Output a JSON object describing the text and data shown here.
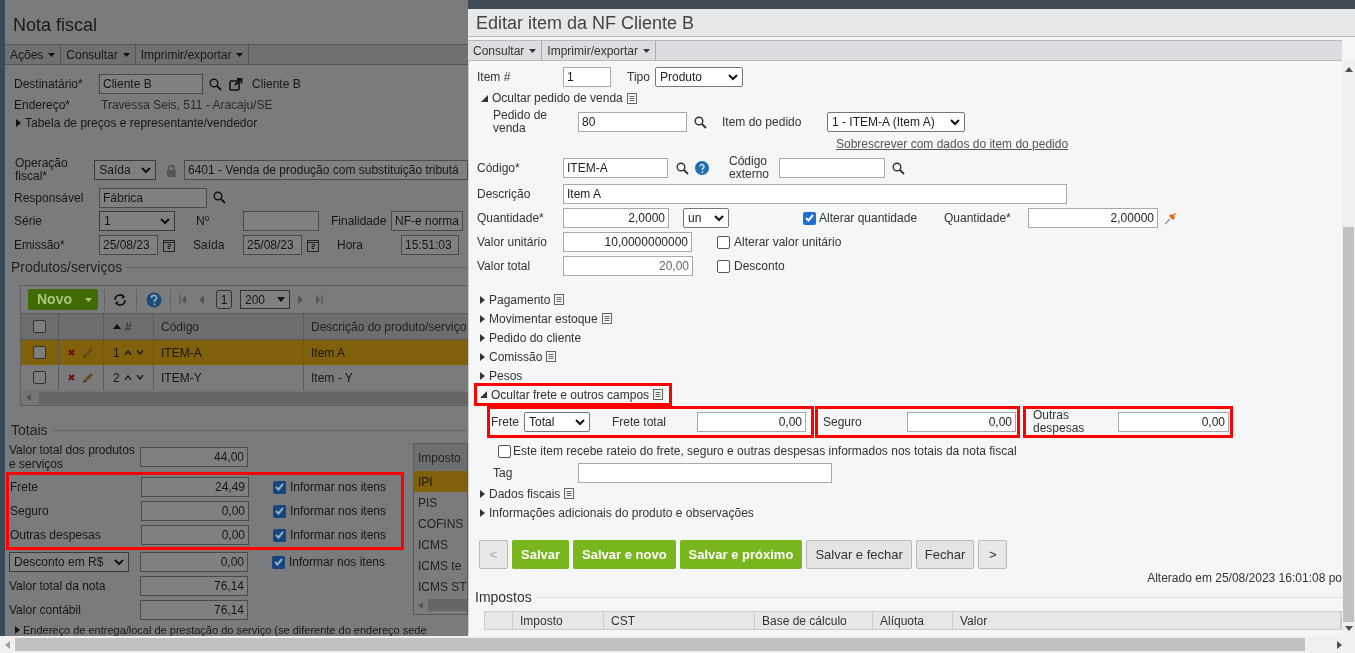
{
  "nota_fiscal": {
    "title": "Nota fiscal",
    "menu": [
      {
        "label": "Ações"
      },
      {
        "label": "Consultar"
      },
      {
        "label": "Imprimir/exportar"
      }
    ],
    "recipient": {
      "label": "Destinatário*",
      "value": "Cliente B",
      "link": "Cliente B"
    },
    "address": {
      "label": "Endereço*",
      "value": "Travessa Seis, 511 - Aracaju/SE"
    },
    "price_table_toggle": "Tabela de preços e representante/vendedor",
    "operation": {
      "label": "Operação fiscal*",
      "direction": "Saída",
      "cfop": "6401 - Venda de produção com substituição tributá"
    },
    "responsible": {
      "label": "Responsável",
      "value": "Fábrica"
    },
    "series": {
      "label": "Série",
      "value": "1"
    },
    "number": {
      "label": "Nº"
    },
    "purpose": {
      "label": "Finalidade",
      "value": "NF-e norma"
    },
    "issue_date": {
      "label": "Emissão*",
      "value": "25/08/23"
    },
    "exit_date": {
      "label": "Saída",
      "value": "25/08/23"
    },
    "time": {
      "label": "Hora",
      "value": "15:51:03"
    },
    "products": {
      "heading": "Produtos/serviços",
      "new_button": "Novo",
      "page": "1",
      "page_size": "200",
      "select_all_checked": false,
      "columns": [
        "#",
        "Código",
        "Descrição do produto/serviço"
      ],
      "rows": [
        {
          "number": "1",
          "code": "ITEM-A",
          "description": "Item A",
          "selected": true,
          "checked": false
        },
        {
          "number": "2",
          "code": "ITEM-Y",
          "description": "Item - Y",
          "selected": false,
          "checked": false
        }
      ]
    },
    "totals": {
      "heading": "Totais",
      "rows": [
        {
          "kind": "readonly",
          "label": "Valor total dos produtos e serviços",
          "value": "44,00",
          "highlighted": false
        },
        {
          "kind": "editable",
          "label": "Frete",
          "value": "24,49",
          "highlighted": true,
          "inform": {
            "label": "Informar nos itens",
            "checked": true
          }
        },
        {
          "kind": "editable",
          "label": "Seguro",
          "value": "0,00",
          "highlighted": true,
          "inform": {
            "label": "Informar nos itens",
            "checked": true
          }
        },
        {
          "kind": "editable",
          "label": "Outras despesas",
          "value": "0,00",
          "highlighted": true,
          "inform": {
            "label": "Informar nos itens",
            "checked": true
          }
        },
        {
          "kind": "select",
          "label": "Desconto em R$",
          "value": "0,00",
          "highlighted": false,
          "inform": {
            "label": "Informar nos itens",
            "checked": true
          }
        },
        {
          "kind": "readonly",
          "label": "Valor total da nota",
          "value": "76,14",
          "highlighted": false
        },
        {
          "kind": "readonly",
          "label": "Valor contábil",
          "value": "76,14",
          "highlighted": false
        }
      ]
    },
    "taxes": {
      "heading": "Imposto",
      "rows": [
        {
          "label": "IPI",
          "selected": true
        },
        {
          "label": "PIS",
          "selected": false
        },
        {
          "label": "COFINS",
          "selected": false
        },
        {
          "label": "ICMS",
          "selected": false
        },
        {
          "label": "ICMS te",
          "selected": false
        },
        {
          "label": "ICMS ST",
          "selected": false
        }
      ]
    },
    "footer_toggle": "Endereço de entrega/local de prestação do serviço (se diferente do endereço sede"
  },
  "item_dialog": {
    "title": "Editar item da NF Cliente B",
    "menu": [
      {
        "label": "Consultar"
      },
      {
        "label": "Imprimir/exportar"
      }
    ],
    "item_number": {
      "label": "Item #",
      "value": "1"
    },
    "type": {
      "label": "Tipo",
      "value": "Produto"
    },
    "sales_order_toggle": {
      "label": "Ocultar pedido de venda",
      "expanded": true
    },
    "sales_order": {
      "label": "Pedido de venda",
      "value": "80"
    },
    "order_item": {
      "label": "Item do pedido",
      "value": "1 - ITEM-A (Item A)"
    },
    "overwrite_link": "Sobrescrever com dados do item do pedido",
    "code": {
      "label": "Código*",
      "value": "ITEM-A"
    },
    "external_code": {
      "label": "Código externo"
    },
    "description": {
      "label": "Descrição",
      "value": "Item A"
    },
    "quantity": {
      "label": "Quantidade*",
      "value": "2,0000",
      "unit": "un"
    },
    "change_quantity": {
      "label": "Alterar quantidade",
      "checked": true
    },
    "quantity_alt": {
      "label": "Quantidade*",
      "value": "2,00000"
    },
    "unit_price": {
      "label": "Valor unitário",
      "value": "10,0000000000"
    },
    "change_unit_price": {
      "label": "Alterar valor unitário",
      "checked": false
    },
    "total": {
      "label": "Valor total",
      "value": "20,00"
    },
    "discount": {
      "label": "Desconto",
      "checked": false
    },
    "sections": [
      {
        "label": "Pagamento",
        "expanded": false,
        "note_icon": true,
        "highlighted": false
      },
      {
        "label": "Movimentar estoque",
        "expanded": false,
        "note_icon": true,
        "highlighted": false
      },
      {
        "label": "Pedido do cliente",
        "expanded": false,
        "note_icon": false,
        "highlighted": false
      },
      {
        "label": "Comissão",
        "expanded": false,
        "note_icon": true,
        "highlighted": false
      },
      {
        "label": "Pesos",
        "expanded": false,
        "note_icon": false,
        "highlighted": false
      },
      {
        "label": "Ocultar frete e outros campos",
        "expanded": true,
        "note_icon": true,
        "highlighted": true
      }
    ],
    "freight": {
      "label": "Frete",
      "mode": "Total",
      "total_label": "Frete total",
      "total_value": "0,00",
      "highlighted": true
    },
    "insurance": {
      "label": "Seguro",
      "value": "0,00",
      "highlighted": true
    },
    "other_expenses": {
      "label": "Outras despesas",
      "value": "0,00",
      "highlighted": true
    },
    "apportion": {
      "label": "Este item recebe rateio do frete, seguro e outras despesas informados nos totais da nota fiscal",
      "checked": false
    },
    "tag": {
      "label": "Tag"
    },
    "more_sections": [
      {
        "label": "Dados fiscais",
        "expanded": false,
        "note_icon": true
      },
      {
        "label": "Informações adicionais do produto e observações",
        "expanded": false,
        "note_icon": false
      }
    ],
    "buttons": [
      {
        "label": "<",
        "kind": "nav",
        "disabled": true
      },
      {
        "label": "Salvar",
        "kind": "primary",
        "disabled": false
      },
      {
        "label": "Salvar e novo",
        "kind": "primary",
        "disabled": false
      },
      {
        "label": "Salvar e próximo",
        "kind": "primary",
        "disabled": false
      },
      {
        "label": "Salvar e fechar",
        "kind": "secondary",
        "disabled": false
      },
      {
        "label": "Fechar",
        "kind": "secondary",
        "disabled": false
      },
      {
        "label": ">",
        "kind": "nav",
        "disabled": false
      }
    ],
    "changed_note": "Alterado em 25/08/2023 16:01:08 po",
    "taxes": {
      "heading": "Impostos",
      "columns": [
        "Imposto",
        "CST",
        "Base de cálculo",
        "Alíquota",
        "Valor"
      ]
    }
  }
}
